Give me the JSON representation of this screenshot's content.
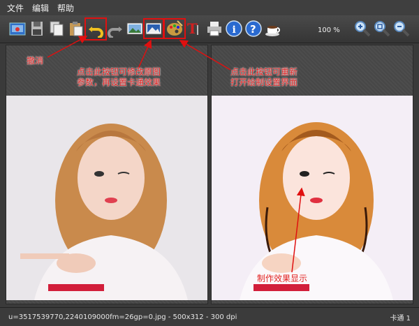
{
  "menu": {
    "file": "文件",
    "edit": "编辑",
    "help": "帮助"
  },
  "toolbar": {
    "zoom": "100 %",
    "icons": [
      "open-icon",
      "save-icon",
      "copy-icon",
      "paste-icon",
      "undo-icon",
      "redo-icon",
      "landscape-icon",
      "image-params-icon",
      "palette-icon",
      "text-icon",
      "print-icon",
      "info-icon",
      "help-icon",
      "coffee-icon",
      "zoom-in-icon",
      "zoom-fit-icon",
      "zoom-out-icon"
    ]
  },
  "annotations": {
    "undo": "撤消",
    "params_line1": "点击此按钮可修改原图",
    "params_line2": "参数，再设置卡通效果",
    "settings_line1": "点击此按钮可重新",
    "settings_line2": "打开绘制设置界面",
    "preview": "制作效果显示"
  },
  "statusbar": {
    "file_info": "u=3517539770,2240109000fm=26gp=0.jpg - 500x312 - 300 dpi",
    "mode": "卡通 1"
  },
  "colors": {
    "accent": "#e01010",
    "panel": "#474747"
  }
}
